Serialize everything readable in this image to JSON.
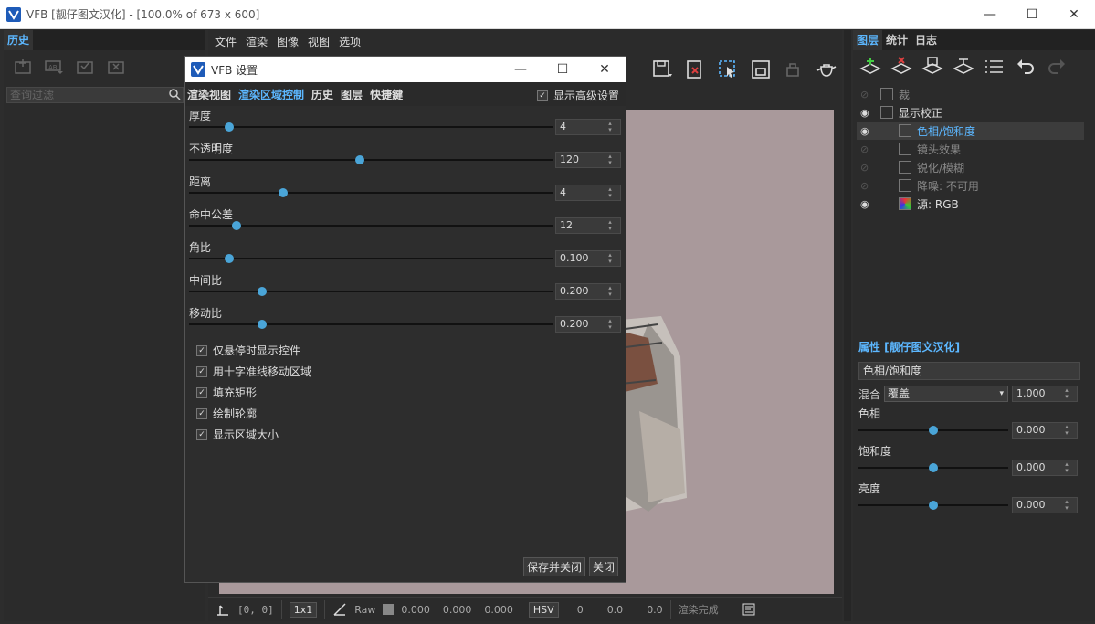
{
  "window": {
    "title": "VFB [靓仔图文汉化] - [100.0% of 673 x 600]"
  },
  "left": {
    "tab": "历史",
    "search_placeholder": "查询过滤"
  },
  "menu": [
    "文件",
    "渲染",
    "图像",
    "视图",
    "选项"
  ],
  "right": {
    "tabs": [
      "图层",
      "统计",
      "日志"
    ],
    "layers": [
      {
        "label": "裁",
        "visible": false,
        "style": "dim",
        "indent": 0
      },
      {
        "label": "显示校正",
        "visible": true,
        "style": "normal",
        "indent": 0
      },
      {
        "label": "色相/饱和度",
        "visible": true,
        "style": "hl",
        "indent": 1
      },
      {
        "label": "镜头效果",
        "visible": false,
        "style": "dim",
        "indent": 1
      },
      {
        "label": "锐化/模糊",
        "visible": false,
        "style": "dim",
        "indent": 1
      },
      {
        "label": "降噪: 不可用",
        "visible": false,
        "style": "dim",
        "indent": 1
      },
      {
        "label": "源: RGB",
        "visible": true,
        "style": "normal",
        "indent": 1
      }
    ],
    "props_tab": "属性 [靓仔图文汉化]",
    "props_name": "色相/饱和度",
    "blend_label": "混合",
    "blend_value": "覆盖",
    "blend_amount": "1.000",
    "sliders": [
      {
        "label": "色相",
        "value": "0.000",
        "pos": 0.5
      },
      {
        "label": "饱和度",
        "value": "0.000",
        "pos": 0.5
      },
      {
        "label": "亮度",
        "value": "0.000",
        "pos": 0.5
      }
    ]
  },
  "dialog": {
    "title": "VFB 设置",
    "tabs": [
      "渲染视图",
      "渲染区域控制",
      "历史",
      "图层",
      "快捷鍵"
    ],
    "active_tab": 1,
    "advanced_label": "显示高级设置",
    "sliders": [
      {
        "label": "厚度",
        "value": "4",
        "pos": 0.11
      },
      {
        "label": "不透明度",
        "value": "120",
        "pos": 0.47
      },
      {
        "label": "距离",
        "value": "4",
        "pos": 0.26
      },
      {
        "label": "命中公差",
        "value": "12",
        "pos": 0.13
      },
      {
        "label": "角比",
        "value": "0.100",
        "pos": 0.11
      },
      {
        "label": "中间比",
        "value": "0.200",
        "pos": 0.2
      },
      {
        "label": "移动比",
        "value": "0.200",
        "pos": 0.2
      }
    ],
    "checks": [
      "仅悬停时显示控件",
      "用十字准线移动区域",
      "填充矩形",
      "绘制轮廓",
      "显示区域大小"
    ],
    "save_close": "保存并关闭",
    "close": "关闭"
  },
  "status": {
    "coords": "[0, 0]",
    "zoom": "1x1",
    "raw": "Raw",
    "vals": [
      "0.000",
      "0.000",
      "0.000"
    ],
    "mode": "HSV",
    "hsv": [
      "0",
      "0.0",
      "0.0"
    ],
    "done": "渲染完成"
  },
  "colors": {
    "accent": "#5cb7ff",
    "viewport_bg": "#a9999b"
  }
}
